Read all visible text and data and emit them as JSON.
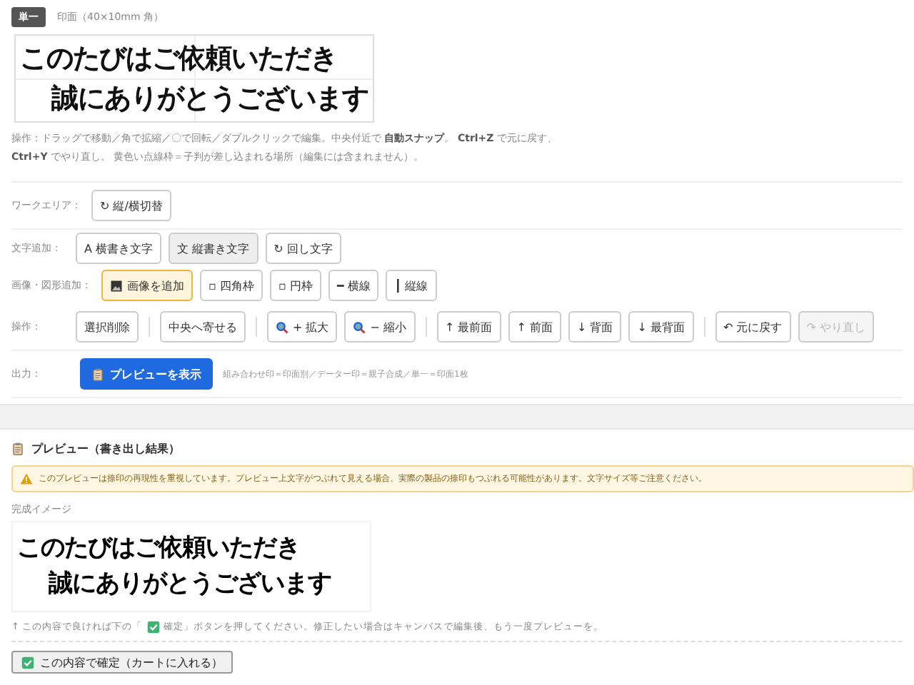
{
  "header": {
    "badge": "単一",
    "title": "印面（40×10mm 角）"
  },
  "canvas": {
    "lines": [
      "このたびはご依頼いただき",
      "誠にありがとうございます"
    ]
  },
  "hint": "操作：ドラッグで移動／角で拡縮／〇で回転／ダブルクリックで編集。中央付近で **自動スナップ**。 **Ctrl+Z** で元に戻す、**Ctrl+Y** でやり直し。 黄色い点線枠＝子判が差し込まれる場所（編集には含まれません）。",
  "toolbar": [
    {
      "label": "ワークエリア：",
      "groups": [
        [
          {
            "label": "↻ 縦/横切替",
            "kind": "plain",
            "disabled": false
          }
        ]
      ]
    },
    {
      "label": "文字追加：",
      "groups": [
        [
          {
            "label": "A 横書き文字",
            "kind": "plain",
            "selected": false,
            "disabled": false
          },
          {
            "label": "文 縦書き文字",
            "kind": "plain",
            "selected": true,
            "disabled": false
          },
          {
            "label": "↻ 回し文字",
            "kind": "plain",
            "selected": false,
            "disabled": false
          }
        ]
      ]
    },
    {
      "label": "画像・図形追加：",
      "groups": [
        [
          {
            "label": "画像を追加",
            "kind": "image",
            "selected": true,
            "disabled": false
          },
          {
            "label": "▫ 四角枠",
            "kind": "plain",
            "selected": false,
            "disabled": false
          },
          {
            "label": "▫ 円枠",
            "kind": "plain",
            "selected": false,
            "disabled": false
          },
          {
            "label": "━ 横線",
            "kind": "plain",
            "selected": false,
            "disabled": false
          },
          {
            "label": "┃ 縦線",
            "kind": "plain",
            "selected": false,
            "disabled": false
          }
        ]
      ]
    },
    {
      "label": "操作：",
      "groups": [
        [
          {
            "label": "選択削除",
            "kind": "plain",
            "disabled": false
          }
        ],
        [
          {
            "label": "中央へ寄せる",
            "kind": "plain",
            "disabled": false
          }
        ],
        [
          {
            "label": "+ 拡大",
            "kind": "zoom",
            "disabled": false
          },
          {
            "label": "− 縮小",
            "kind": "zoom",
            "disabled": false
          }
        ],
        [
          {
            "label": "↑ 最前面",
            "kind": "plain",
            "disabled": false
          },
          {
            "label": "↑ 前面",
            "kind": "plain",
            "disabled": false
          },
          {
            "label": "↓ 背面",
            "kind": "plain",
            "disabled": false
          },
          {
            "label": "↓ 最背面",
            "kind": "plain",
            "disabled": false
          }
        ],
        [
          {
            "label": "↶ 元に戻す",
            "kind": "plain",
            "disabled": false
          },
          {
            "label": "↷ やり直し",
            "kind": "plain",
            "disabled": true
          }
        ]
      ]
    },
    {
      "label": "出力：",
      "primary": {
        "label": "プレビューを表示"
      },
      "note": "組み合わせ印＝印面別／データー印＝親子合成／単一＝印面1枚"
    }
  ],
  "preview": {
    "title": "プレビュー（書き出し結果）",
    "warning": "このプレビューは捺印の再現性を重視しています。プレビュー上文字がつぶれて見える場合、実際の製品の捺印もつぶれる可能性があります。文字サイズ等ご注意ください。",
    "image_label": "完成イメージ",
    "lines": [
      "このたびはご依頼いただき",
      "誠にありがとうございます"
    ],
    "note_before": "↑ この内容で良ければ下の「",
    "note_after": "確定」ボタンを押してください。修正したい場合はキャンバスで編集後、もう一度プレビューを。",
    "confirm": "この内容で確定（カートに入れる）"
  }
}
